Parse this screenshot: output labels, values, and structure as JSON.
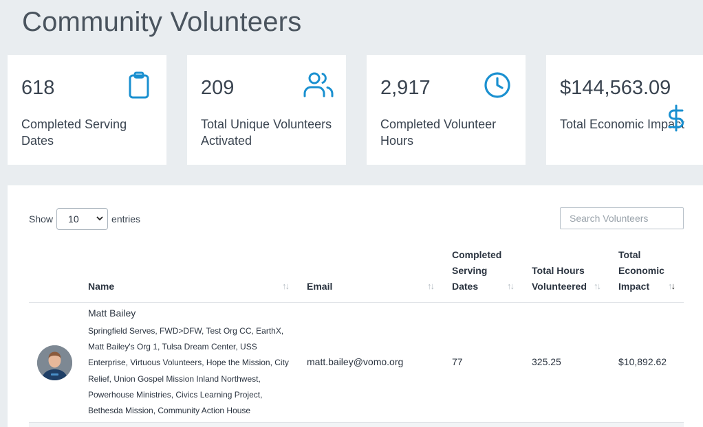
{
  "page": {
    "title": "Community Volunteers"
  },
  "stats": [
    {
      "value": "618",
      "label": "Completed Serving Dates",
      "icon": "clipboard-icon"
    },
    {
      "value": "209",
      "label": "Total Unique Volunteers Activated",
      "icon": "users-icon"
    },
    {
      "value": "2,917",
      "label": "Completed Volunteer Hours",
      "icon": "clock-icon"
    },
    {
      "value": "$144,563.09",
      "label": "Total Economic Impact",
      "icon": "dollar-icon"
    }
  ],
  "colors": {
    "accent": "#1a90d0",
    "background": "#e9edf0",
    "card": "#ffffff"
  },
  "table": {
    "length": {
      "prefix": "Show",
      "selected": "10",
      "suffix": "entries"
    },
    "search": {
      "placeholder": "Search Volunteers"
    },
    "columns": [
      "Name",
      "Email",
      "Completed Serving Dates",
      "Total Hours Volunteered",
      "Total Economic Impact"
    ],
    "rows": [
      {
        "name": "Matt Bailey",
        "orgs": "Springfield Serves, FWD>DFW, Test Org CC, EarthX, Matt Bailey's Org 1, Tulsa Dream Center, USS Enterprise, Virtuous Volunteers, Hope the Mission, City Relief, Union Gospel Mission Inland Northwest, Powerhouse Ministries, Civics Learning Project, Bethesda Mission, Community Action House",
        "email": "matt.bailey@vomo.org",
        "dates": "77",
        "hours": "325.25",
        "impact": "$10,892.62"
      }
    ]
  }
}
